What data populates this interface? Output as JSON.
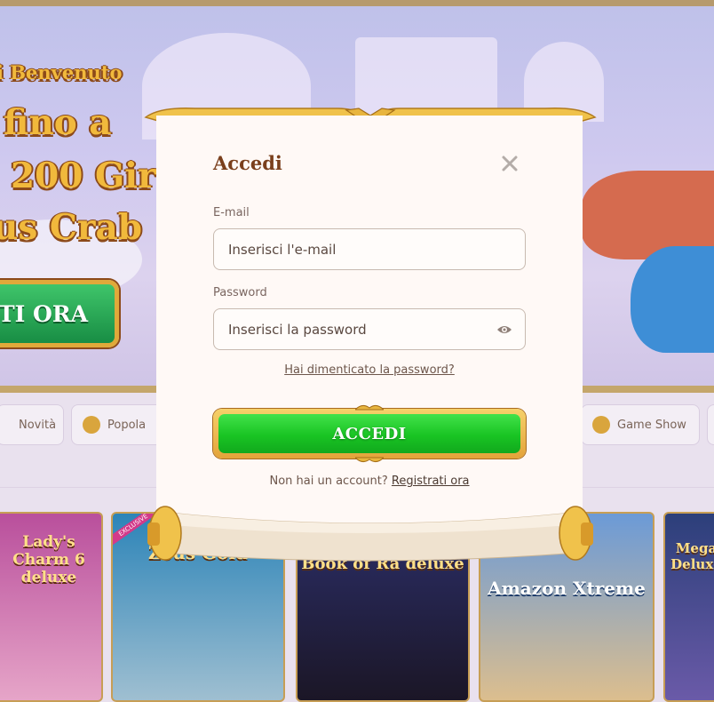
{
  "background": {
    "hero_lines": [
      "i Benvenuto",
      "fino a",
      "200 Gir",
      "us Crab"
    ],
    "hero_cta": "TI ORA",
    "categories": [
      {
        "label": "Novità"
      },
      {
        "label": "Popola"
      },
      {
        "label": "Game Show"
      }
    ],
    "games": [
      "Lady's Charm 6 deluxe",
      "Zeus Gold",
      "Book of Ra deluxe",
      "Amazon Xtreme",
      "Mega Deluxe"
    ],
    "game_badge": "EXCLUSIVE"
  },
  "modal": {
    "title": "Accedi",
    "email_label": "E-mail",
    "email_placeholder": "Inserisci l'e-mail",
    "password_label": "Password",
    "password_placeholder": "Inserisci la password",
    "forgot_link": "Hai dimenticato la password?",
    "login_button": "ACCEDI",
    "no_account_text": "Non hai un account?",
    "register_link": "Registrati ora"
  },
  "colors": {
    "title": "#7a3f1c",
    "button_green": "#19c423",
    "button_gold": "#e3a33a",
    "modal_bg": "#fff9f6"
  }
}
